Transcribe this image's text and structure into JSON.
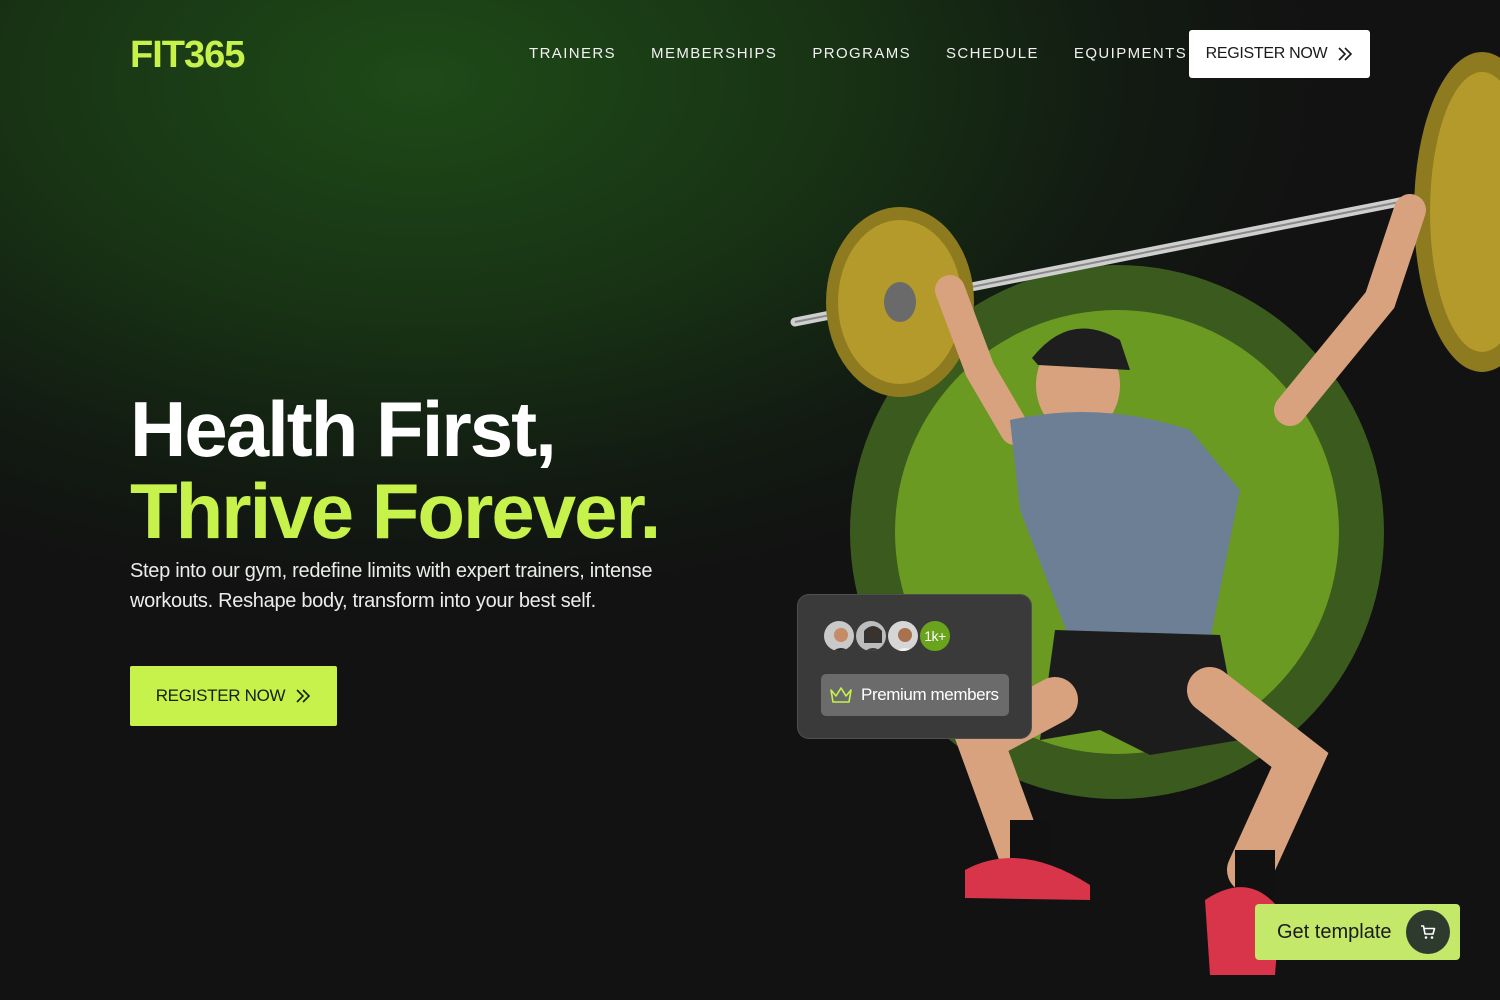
{
  "brand": {
    "logo": "FIT365"
  },
  "nav": {
    "items": [
      {
        "label": "TRAINERS"
      },
      {
        "label": "MEMBERSHIPS"
      },
      {
        "label": "PROGRAMS"
      },
      {
        "label": "SCHEDULE"
      },
      {
        "label": "EQUIPMENTS"
      }
    ],
    "cta_label": "REGISTER NOW",
    "cta_icon": "chevrons-right-icon"
  },
  "hero": {
    "title_line1": "Health First,",
    "title_line2": "Thrive Forever.",
    "subtitle": "Step into our gym, redefine limits with expert trainers, intense workouts. Reshape body, transform into your best self.",
    "cta_label": "REGISTER NOW",
    "image": "athlete-lifting-barbell-overhead-squat"
  },
  "members_card": {
    "count": "1k+",
    "label": "Premium members",
    "icon": "crown-icon"
  },
  "floating": {
    "get_template_label": "Get template",
    "icon": "cart-icon"
  },
  "colors": {
    "accent": "#c6f24b",
    "background": "#121212",
    "hero_green": "#1e4a18",
    "circle_outer": "#3b5a1d",
    "circle_inner": "#6a9a22"
  }
}
